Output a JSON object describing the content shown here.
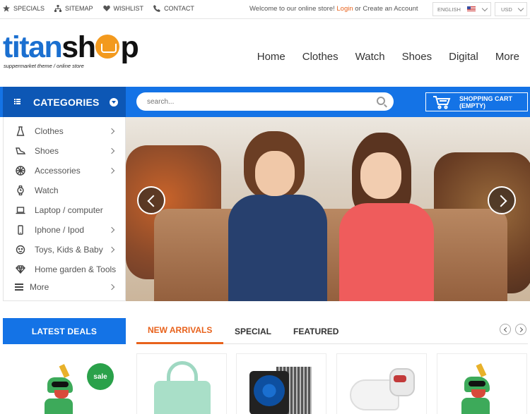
{
  "topbar": {
    "links": [
      "SPECIALS",
      "SITEMAP",
      "WISHLIST",
      "CONTACT"
    ],
    "welcome_prefix": "Welcome to our online store!",
    "login": "Login",
    "welcome_or": "or",
    "create_account": "Create an Account",
    "language": "ENGLISH",
    "currency": "USD"
  },
  "logo": {
    "part1": "titan",
    "part2a": "sh",
    "part2b": "p",
    "tagline": "suppermarket theme / online store"
  },
  "nav": [
    "Home",
    "Clothes",
    "Watch",
    "Shoes",
    "Digital",
    "More"
  ],
  "categories": {
    "title": "CATEGORIES",
    "items": [
      {
        "label": "Clothes",
        "icon": "dress-icon",
        "has_sub": true
      },
      {
        "label": "Shoes",
        "icon": "shoe-icon",
        "has_sub": true
      },
      {
        "label": "Accessories",
        "icon": "accessories-icon",
        "has_sub": true
      },
      {
        "label": "Watch",
        "icon": "watch-icon",
        "has_sub": false
      },
      {
        "label": "Laptop / computer",
        "icon": "laptop-icon",
        "has_sub": false
      },
      {
        "label": "Iphone / Ipod",
        "icon": "phone-icon",
        "has_sub": true
      },
      {
        "label": "Toys, Kids & Baby",
        "icon": "baby-icon",
        "has_sub": true
      },
      {
        "label": "Home garden & Tools",
        "icon": "diamond-icon",
        "has_sub": false
      },
      {
        "label": "More",
        "icon": "more-list-icon",
        "has_sub": true
      }
    ]
  },
  "search": {
    "placeholder": "search..."
  },
  "cart": {
    "title": "SHOPPING CART",
    "status": "(EMPTY)"
  },
  "deals": {
    "title": "LATEST DEALS",
    "badge": "sale"
  },
  "tabs": [
    "NEW ARRIVALS",
    "SPECIAL",
    "FEATURED"
  ],
  "colors": {
    "brand_blue": "#1473e6",
    "accent_orange": "#e8621c",
    "sale_green": "#2aa14a"
  }
}
